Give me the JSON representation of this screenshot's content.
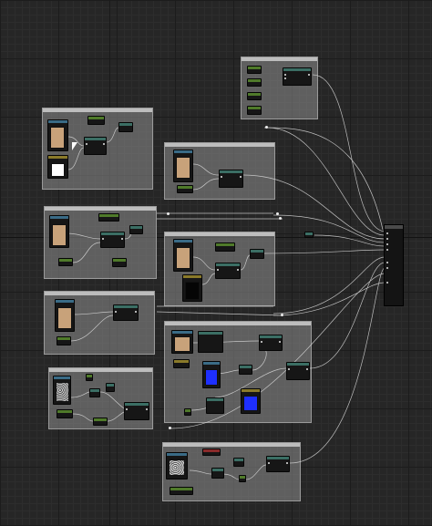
{
  "editor": {
    "type": "material-graph",
    "canvas_color": "#262626",
    "wire_color": "#d9d9d9"
  },
  "comments": [
    {
      "id": "c-top-right",
      "title": ""
    },
    {
      "id": "c-left-1",
      "title": ""
    },
    {
      "id": "c-mid-1",
      "title": ""
    },
    {
      "id": "c-left-2",
      "title": ""
    },
    {
      "id": "c-mid-2",
      "title": ""
    },
    {
      "id": "c-left-3",
      "title": ""
    },
    {
      "id": "c-mid-3",
      "title": ""
    },
    {
      "id": "c-left-4",
      "title": ""
    },
    {
      "id": "c-bottom",
      "title": ""
    }
  ],
  "swatches": {
    "tan": "#c8a27a",
    "white": "#ffffff",
    "black": "#050505",
    "blue": "#1e2fff",
    "noise": "#9a9a9a"
  },
  "header_colors": {
    "texture": "#3a6b86",
    "param": "#4f7a2a",
    "math": "#3b6e64",
    "const": "#8a7a2a",
    "vector": "#8a2a2a",
    "output": "#5a5a5a"
  }
}
